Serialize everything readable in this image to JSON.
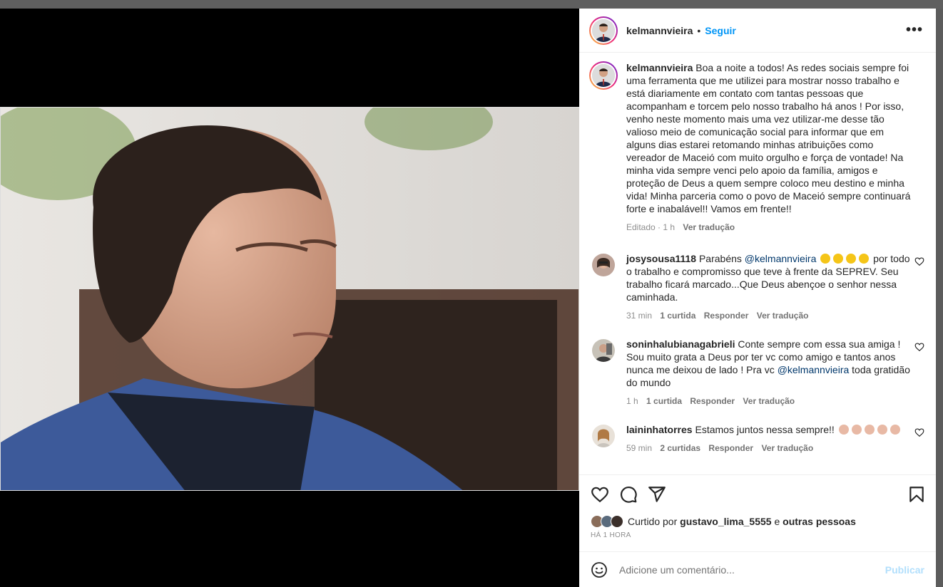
{
  "post": {
    "username": "kelmannvieira",
    "dot": "•",
    "follow_label": "Seguir",
    "more_label": "•••",
    "caption": "Boa a noite a todos! As redes sociais sempre foi uma ferramenta que me utilizei para mostrar nosso trabalho e está diariamente em contato com tantas pessoas que acompanham e torcem pelo nosso trabalho há anos ! Por isso, venho neste momento mais uma vez utilizar-me desse tão valioso meio de comunicação social para informar que em alguns dias estarei retomando minhas atribuições como vereador de Maceió com muito orgulho e força de vontade! Na minha vida sempre venci pelo apoio da família, amigos e proteção de Deus a quem sempre coloco meu destino e minha vida! Minha parceria como o povo de Maceió sempre continuará forte e inabalável!! Vamos em frente!!",
    "caption_meta": {
      "edited": "Editado · 1 h",
      "translate": "Ver tradução"
    }
  },
  "comments": [
    {
      "username": "josysousa1118",
      "text_before": "Parabéns",
      "mention": "@kelmannvieira",
      "text_after": "por todo o trabalho e compromisso que teve à frente da SEPREV. Seu trabalho ficará marcado...Que Deus abençoe o senhor nessa caminhada.",
      "time": "31 min",
      "likes": "1 curtida",
      "reply": "Responder",
      "translate": "Ver tradução"
    },
    {
      "username": "soninhalubianagabrieli",
      "text_before": "Conte sempre com essa sua amiga ! Sou muito grata a Deus por ter vc como amigo e tantos anos nunca me deixou de lado ! Pra vc",
      "mention": "@kelmannvieira",
      "text_after": "toda gratidão do mundo",
      "time": "1 h",
      "likes": "1 curtida",
      "reply": "Responder",
      "translate": "Ver tradução"
    },
    {
      "username": "laininhatorres",
      "text_before": "Estamos juntos nessa sempre!!",
      "time": "59 min",
      "likes": "2 curtidas",
      "reply": "Responder",
      "translate": "Ver tradução"
    }
  ],
  "likes": {
    "prefix": "Curtido por",
    "user": "gustavo_lima_5555",
    "connector": "e",
    "others": "outras pessoas",
    "time_ago": "HÁ 1 HORA"
  },
  "add_comment": {
    "placeholder": "Adicione um comentário...",
    "publish_label": "Publicar"
  },
  "colors": {
    "link_blue": "#0095f6",
    "publish_disabled": "#b2dffc",
    "mention": "#00376b",
    "muted": "#8e8e8e"
  }
}
